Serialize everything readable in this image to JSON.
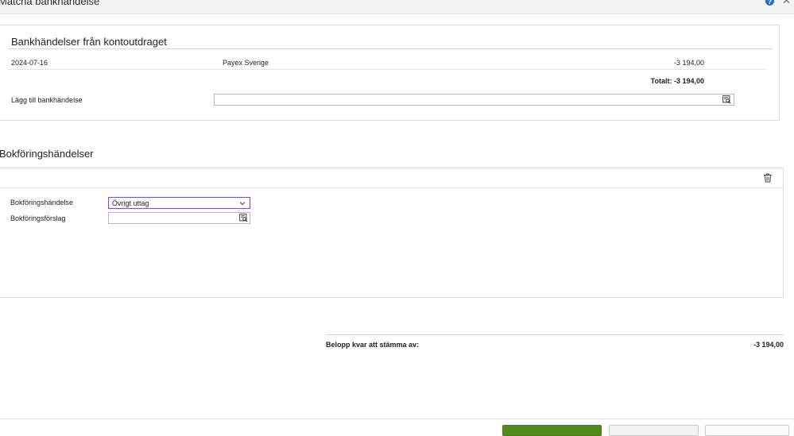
{
  "dialog": {
    "title": "Matcha bankhändelse",
    "help_icon": "help-icon",
    "close_icon": "close-icon"
  },
  "bank_section": {
    "heading": "Bankhändelser från kontoutdraget",
    "transactions": [
      {
        "date": "2024-07-16",
        "name": "Payex Sverige",
        "amount": "-3 194,00"
      }
    ],
    "total": "Totalt: -3 194,00",
    "add_label": "Lägg till bankhändelse",
    "add_value": ""
  },
  "booking_section": {
    "heading": "Bokföringshändelser",
    "delete_icon": "trash-icon",
    "event_label": "Bokföringshändelse",
    "event_value": "Övrigt uttag",
    "suggestion_label": "Bokföringsförslag",
    "suggestion_value": ""
  },
  "summary": {
    "remaining_label": "Belopp kvar att stämma av:",
    "remaining_value": "-3 194,00"
  },
  "colors": {
    "primary_button": "#4f8a1c",
    "select_focus": "#7b4fc0",
    "help_icon": "#1f6fd0"
  }
}
